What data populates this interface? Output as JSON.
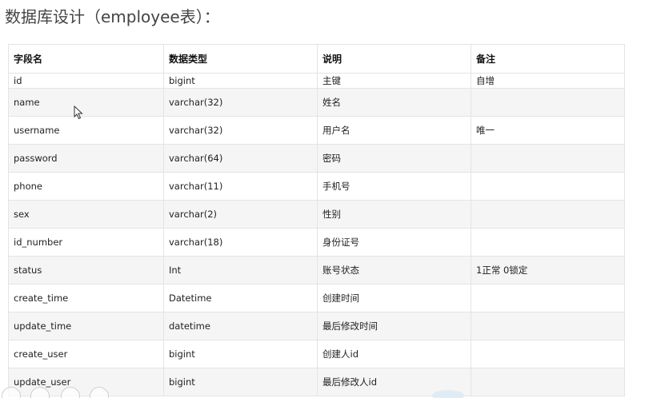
{
  "title": "数据库设计（employee表）：",
  "table": {
    "headers": [
      "字段名",
      "数据类型",
      "说明",
      "备注"
    ],
    "rows": [
      [
        "id",
        "bigint",
        "主键",
        "自增"
      ],
      [
        "name",
        "varchar(32)",
        "姓名",
        ""
      ],
      [
        "username",
        "varchar(32)",
        "用户名",
        "唯一"
      ],
      [
        "password",
        "varchar(64)",
        "密码",
        ""
      ],
      [
        "phone",
        "varchar(11)",
        "手机号",
        ""
      ],
      [
        "sex",
        "varchar(2)",
        "性别",
        ""
      ],
      [
        "id_number",
        "varchar(18)",
        "身份证号",
        ""
      ],
      [
        "status",
        "Int",
        "账号状态",
        "1正常 0锁定"
      ],
      [
        "create_time",
        "Datetime",
        "创建时间",
        ""
      ],
      [
        "update_time",
        "datetime",
        "最后修改时间",
        ""
      ],
      [
        "create_user",
        "bigint",
        "创建人id",
        ""
      ],
      [
        "update_user",
        "bigint",
        "最后修改人id",
        ""
      ]
    ]
  },
  "icons": {
    "cursor": "mouse-pointer-icon",
    "toolbar": [
      "pen-icon",
      "grid-icon",
      "search-icon",
      "more-icon"
    ]
  },
  "colors": {
    "row_alt": "#f5f5f5",
    "border": "#e4e4e4",
    "title": "#444444"
  }
}
